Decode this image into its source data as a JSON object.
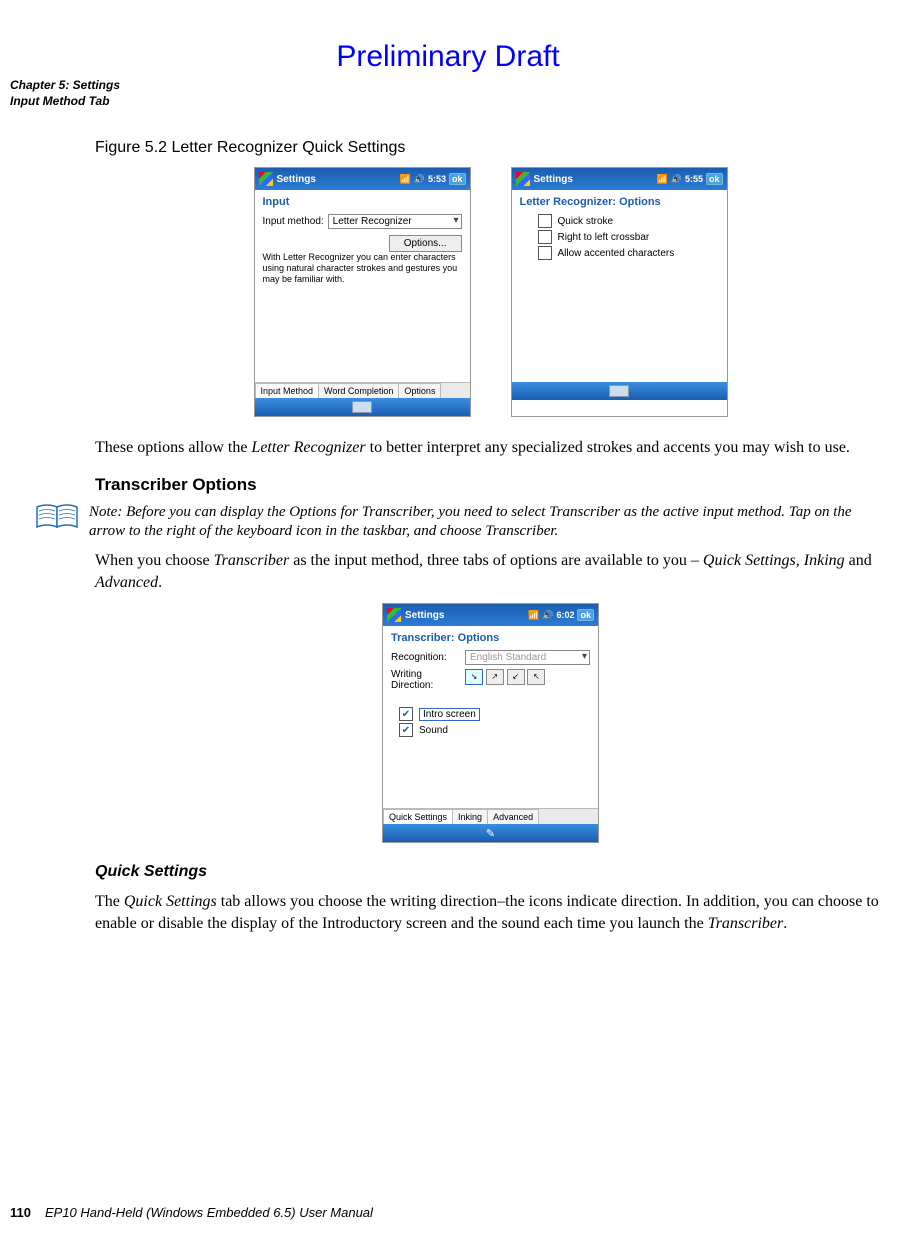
{
  "draft_label": "Preliminary Draft",
  "chapter_line1": "Chapter 5: Settings",
  "chapter_line2": "Input Method Tab",
  "figure_caption": "Figure 5.2  Letter Recognizer Quick Settings",
  "screen1": {
    "titlebar": "Settings",
    "time": "5:53",
    "ok": "ok",
    "subtitle": "Input",
    "label_input_method": "Input method:",
    "select_value": "Letter Recognizer",
    "options_btn": "Options...",
    "desc": "With Letter Recognizer you can enter characters using natural character strokes and gestures you may be familiar with.",
    "tabs": [
      "Input Method",
      "Word Completion",
      "Options"
    ]
  },
  "screen2": {
    "titlebar": "Settings",
    "time": "5:55",
    "ok": "ok",
    "subtitle": "Letter Recognizer: Options",
    "opt1": "Quick stroke",
    "opt2": "Right to left crossbar",
    "opt3": "Allow accented characters"
  },
  "para1a": "These options allow the ",
  "para1b": "Letter Recognizer",
  "para1c": " to better interpret any specialized strokes and accents you may wish to use.",
  "sub_transcriber": "Transcriber Options",
  "note_prefix": "Note:",
  "note_body": " Before you can display the Options for Transcriber, you need to select Transcriber as the active input method. Tap on the arrow to the right of the keyboard icon in the taskbar, and choose Transcriber.",
  "para2a": "When you choose ",
  "para2b": "Transcriber",
  "para2c": " as the input method, three tabs of options are available to you – ",
  "para2d": "Quick Settings, Inking",
  "para2e": " and ",
  "para2f": "Advanced",
  "para2g": ".",
  "screen3": {
    "titlebar": "Settings",
    "time": "6:02",
    "ok": "ok",
    "subtitle": "Transcriber: Options",
    "label_recognition": "Recognition:",
    "recognition_value": "English Standard",
    "label_writing": "Writing Direction:",
    "chk_intro": "Intro screen",
    "chk_sound": "Sound",
    "tabs": [
      "Quick Settings",
      "Inking",
      "Advanced"
    ]
  },
  "sub_quick": "Quick Settings",
  "para3a": "The ",
  "para3b": "Quick Settings",
  "para3c": " tab allows you choose the writing direction–the icons indicate direction. In addition, you can choose to enable or disable the display of the Introductory screen and the sound each time you launch the ",
  "para3d": "Transcriber",
  "para3e": ".",
  "footer_page": "110",
  "footer_text": "EP10 Hand-Held (Windows Embedded 6.5) User Manual"
}
